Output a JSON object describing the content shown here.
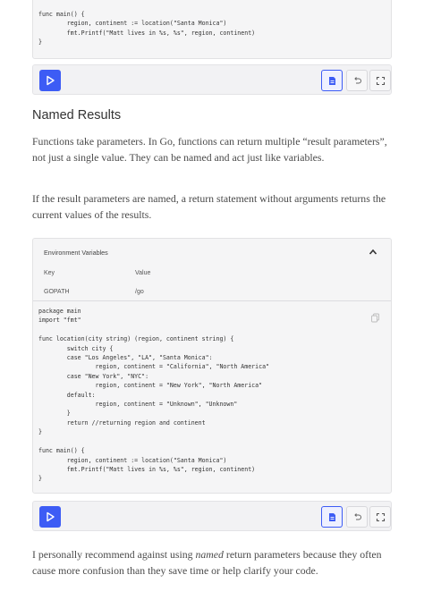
{
  "top_code": {
    "lines": [
      "func main() {",
      "        region, continent := location(\"Santa Monica\")",
      "        fmt.Printf(\"Matt lives in %s, %s\", region, continent)",
      "}"
    ]
  },
  "toolbar_icons": {
    "run": "play-icon",
    "format": "format-document-icon",
    "undo": "undo-icon",
    "fullscreen": "expand-icon"
  },
  "section": {
    "title": "Named Results",
    "para1": "Functions take parameters. In Go, functions can return multiple “result parameters”, not just a single value. They can be named and act just like variables.",
    "para2": "If the result parameters are named, a return statement without arguments returns the current values of the results.",
    "para3_pre": "I personally recommend against using ",
    "para3_em": "named",
    "para3_post": " return parameters because they often cause more confusion than they save time or help clarify your code."
  },
  "env": {
    "title": "Environment Variables",
    "key_header": "Key",
    "value_header": "Value",
    "rows": [
      {
        "key": "GOPATH",
        "value": "/go"
      }
    ]
  },
  "main_code": {
    "lines": [
      "package main",
      "import \"fmt\"",
      "",
      "func location(city string) (region, continent string) {",
      "        switch city {",
      "        case \"Los Angeles\", \"LA\", \"Santa Monica\":",
      "                region, continent = \"California\", \"North America\"",
      "        case \"New York\", \"NYC\":",
      "                region, continent = \"New York\", \"North America\"",
      "        default:",
      "                region, continent = \"Unknown\", \"Unknown\"",
      "        }",
      "        return //returning region and continent",
      "}",
      "",
      "func main() {",
      "        region, continent := location(\"Santa Monica\")",
      "        fmt.Printf(\"Matt lives in %s, %s\", region, continent)",
      "}"
    ]
  },
  "colors": {
    "accent": "#3d5cf5",
    "panel": "#f5f5f6"
  }
}
